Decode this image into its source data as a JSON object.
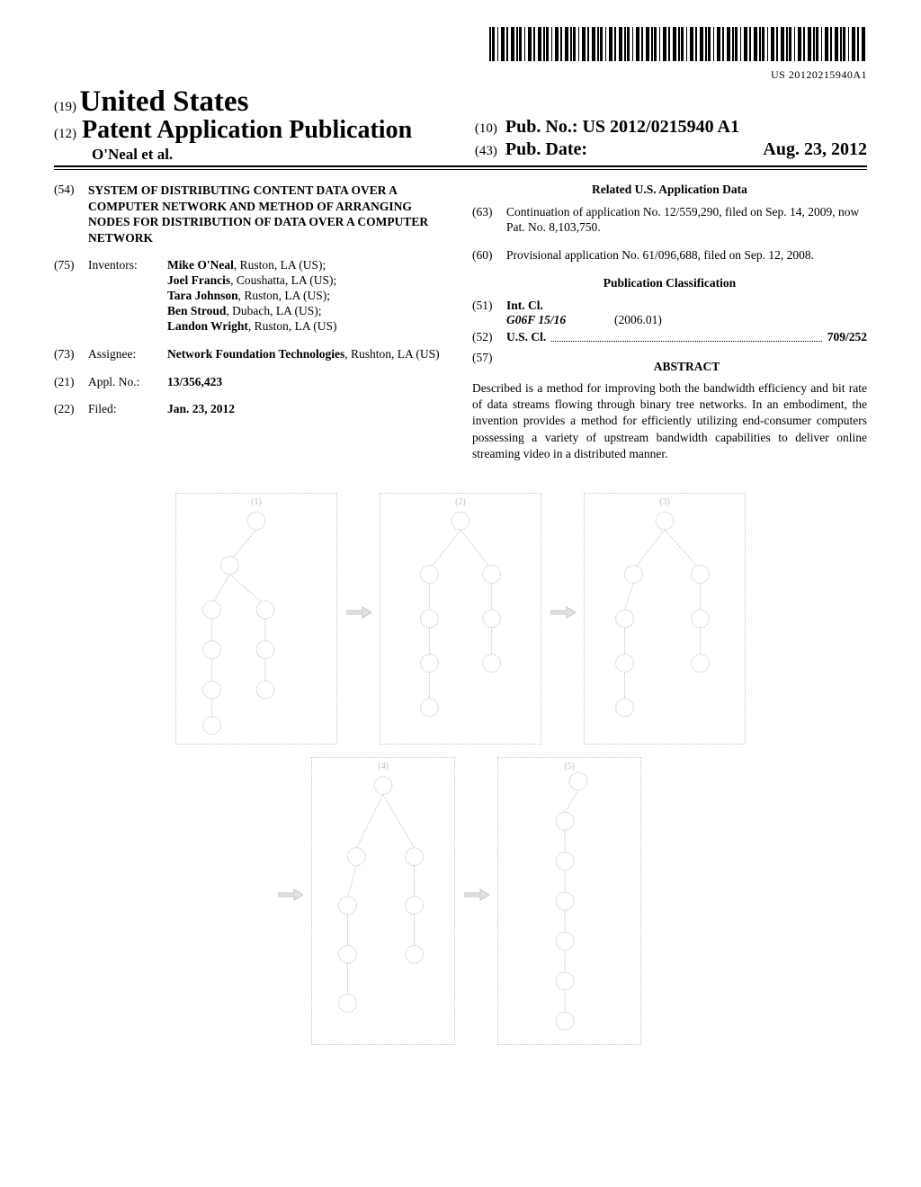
{
  "barcode_sub": "US 20120215940A1",
  "masthead": {
    "pre19": "(19)",
    "country": "United States",
    "pre12": "(12)",
    "kind": "Patent Application Publication",
    "authors_short": "O'Neal et al.",
    "pubno_pre": "(10)",
    "pubno_label": "Pub. No.:",
    "pubno": "US 2012/0215940 A1",
    "pubdate_pre": "(43)",
    "pubdate_label": "Pub. Date:",
    "pubdate": "Aug. 23, 2012"
  },
  "left": {
    "code54": "(54)",
    "title": "SYSTEM OF DISTRIBUTING CONTENT DATA OVER A COMPUTER NETWORK AND METHOD OF ARRANGING NODES FOR DISTRIBUTION OF DATA OVER A COMPUTER NETWORK",
    "code75": "(75)",
    "label75": "Inventors:",
    "inventors": [
      {
        "name": "Mike O'Neal",
        "loc": "Ruston, LA (US);"
      },
      {
        "name": "Joel Francis",
        "loc": "Coushatta, LA (US);"
      },
      {
        "name": "Tara Johnson",
        "loc": "Ruston, LA (US);"
      },
      {
        "name": "Ben Stroud",
        "loc": "Dubach, LA (US);"
      },
      {
        "name": "Landon Wright",
        "loc": "Ruston, LA (US)"
      }
    ],
    "code73": "(73)",
    "label73": "Assignee:",
    "assignee_name": "Network Foundation Technologies",
    "assignee_loc": ", Rushton, LA (US)",
    "code21": "(21)",
    "label21": "Appl. No.:",
    "applno": "13/356,423",
    "code22": "(22)",
    "label22": "Filed:",
    "filed": "Jan. 23, 2012"
  },
  "right": {
    "related_hdr": "Related U.S. Application Data",
    "code63": "(63)",
    "text63": "Continuation of application No. 12/559,290, filed on Sep. 14, 2009, now Pat. No. 8,103,750.",
    "code60": "(60)",
    "text60": "Provisional application No. 61/096,688, filed on Sep. 12, 2008.",
    "pubclass_hdr": "Publication Classification",
    "code51": "(51)",
    "label51": "Int. Cl.",
    "ipc_code": "G06F 15/16",
    "ipc_date": "(2006.01)",
    "code52": "(52)",
    "label52": "U.S. Cl.",
    "uscl": "709/252",
    "code57": "(57)",
    "abstract_hdr": "ABSTRACT",
    "abstract": "Described is a method for improving both the bandwidth efficiency and bit rate of data streams flowing through binary tree networks. In an embodiment, the invention provides a method for efficiently utilizing end-consumer computers possessing a variety of upstream bandwidth capabilities to deliver online streaming video in a distributed manner."
  },
  "figure": {
    "panels": [
      "(1)",
      "(2)",
      "(3)",
      "(4)",
      "(5)"
    ]
  }
}
